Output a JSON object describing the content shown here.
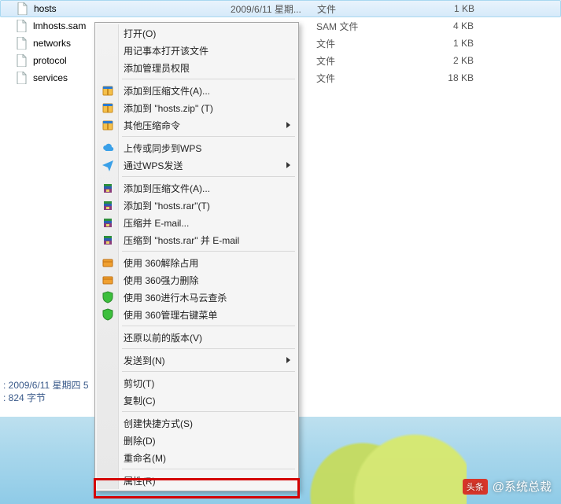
{
  "files": [
    {
      "name": "hosts",
      "date": "2009/6/11 星期...",
      "type": "文件",
      "size": "1 KB",
      "selected": true
    },
    {
      "name": "lmhosts.sam",
      "date": "",
      "type": "SAM 文件",
      "size": "4 KB",
      "selected": false
    },
    {
      "name": "networks",
      "date": "",
      "type": "文件",
      "size": "1 KB",
      "selected": false
    },
    {
      "name": "protocol",
      "date": "",
      "type": "文件",
      "size": "2 KB",
      "selected": false
    },
    {
      "name": "services",
      "date": "",
      "type": "文件",
      "size": "18 KB",
      "selected": false
    }
  ],
  "status": {
    "line1": ": 2009/6/11 星期四 5",
    "line2": ": 824 字节"
  },
  "menu": [
    {
      "kind": "item",
      "label": "打开(O)",
      "icon": null
    },
    {
      "kind": "item",
      "label": "用记事本打开该文件",
      "icon": null
    },
    {
      "kind": "item",
      "label": "添加管理员权限",
      "icon": null
    },
    {
      "kind": "sep"
    },
    {
      "kind": "item",
      "label": "添加到压缩文件(A)...",
      "icon": "zip-blue"
    },
    {
      "kind": "item",
      "label": "添加到 \"hosts.zip\" (T)",
      "icon": "zip-blue"
    },
    {
      "kind": "item",
      "label": "其他压缩命令",
      "icon": "zip-blue",
      "submenu": true
    },
    {
      "kind": "sep"
    },
    {
      "kind": "item",
      "label": "上传或同步到WPS",
      "icon": "cloud"
    },
    {
      "kind": "item",
      "label": "通过WPS发送",
      "icon": "send",
      "submenu": true
    },
    {
      "kind": "sep"
    },
    {
      "kind": "item",
      "label": "添加到压缩文件(A)...",
      "icon": "rar"
    },
    {
      "kind": "item",
      "label": "添加到 \"hosts.rar\"(T)",
      "icon": "rar"
    },
    {
      "kind": "item",
      "label": "压缩并 E-mail...",
      "icon": "rar"
    },
    {
      "kind": "item",
      "label": "压缩到 \"hosts.rar\" 并 E-mail",
      "icon": "rar"
    },
    {
      "kind": "sep"
    },
    {
      "kind": "item",
      "label": "使用 360解除占用",
      "icon": "box"
    },
    {
      "kind": "item",
      "label": "使用 360强力删除",
      "icon": "box"
    },
    {
      "kind": "item",
      "label": "使用 360进行木马云查杀",
      "icon": "shield"
    },
    {
      "kind": "item",
      "label": "使用 360管理右键菜单",
      "icon": "shield"
    },
    {
      "kind": "sep"
    },
    {
      "kind": "item",
      "label": "还原以前的版本(V)",
      "icon": null
    },
    {
      "kind": "sep"
    },
    {
      "kind": "item",
      "label": "发送到(N)",
      "icon": null,
      "submenu": true
    },
    {
      "kind": "sep"
    },
    {
      "kind": "item",
      "label": "剪切(T)",
      "icon": null
    },
    {
      "kind": "item",
      "label": "复制(C)",
      "icon": null
    },
    {
      "kind": "sep"
    },
    {
      "kind": "item",
      "label": "创建快捷方式(S)",
      "icon": null
    },
    {
      "kind": "item",
      "label": "删除(D)",
      "icon": null
    },
    {
      "kind": "item",
      "label": "重命名(M)",
      "icon": null
    },
    {
      "kind": "sep"
    },
    {
      "kind": "item",
      "label": "属性(R)",
      "icon": null
    }
  ],
  "watermark": {
    "badge": "头条",
    "text": "@系统总裁"
  }
}
